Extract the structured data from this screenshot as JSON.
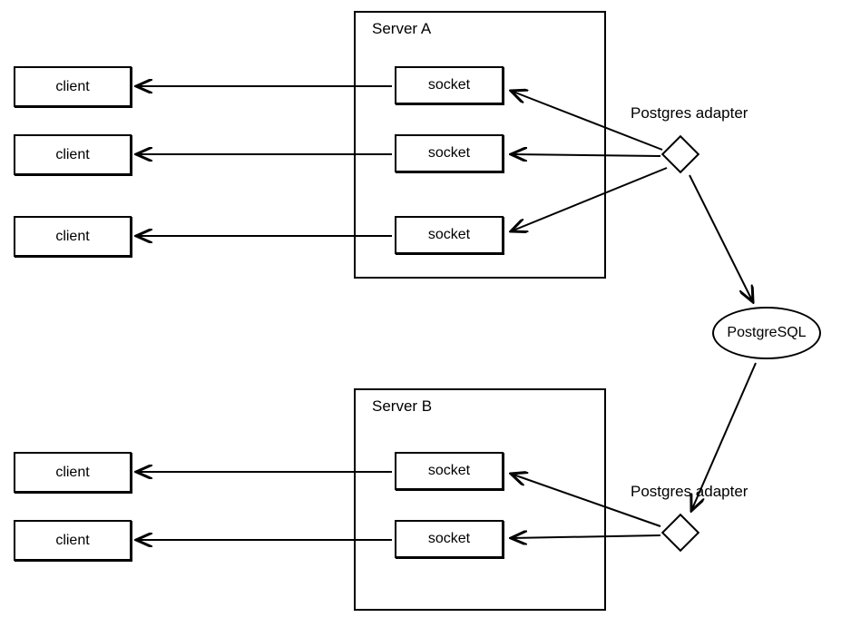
{
  "serverA": {
    "label": "Server A",
    "sockets": [
      "socket",
      "socket",
      "socket"
    ]
  },
  "serverB": {
    "label": "Server B",
    "sockets": [
      "socket",
      "socket"
    ]
  },
  "clientsA": [
    "client",
    "client",
    "client"
  ],
  "clientsB": [
    "client",
    "client"
  ],
  "adapterA": {
    "label": "Postgres adapter"
  },
  "adapterB": {
    "label": "Postgres adapter"
  },
  "database": {
    "label": "PostgreSQL"
  }
}
